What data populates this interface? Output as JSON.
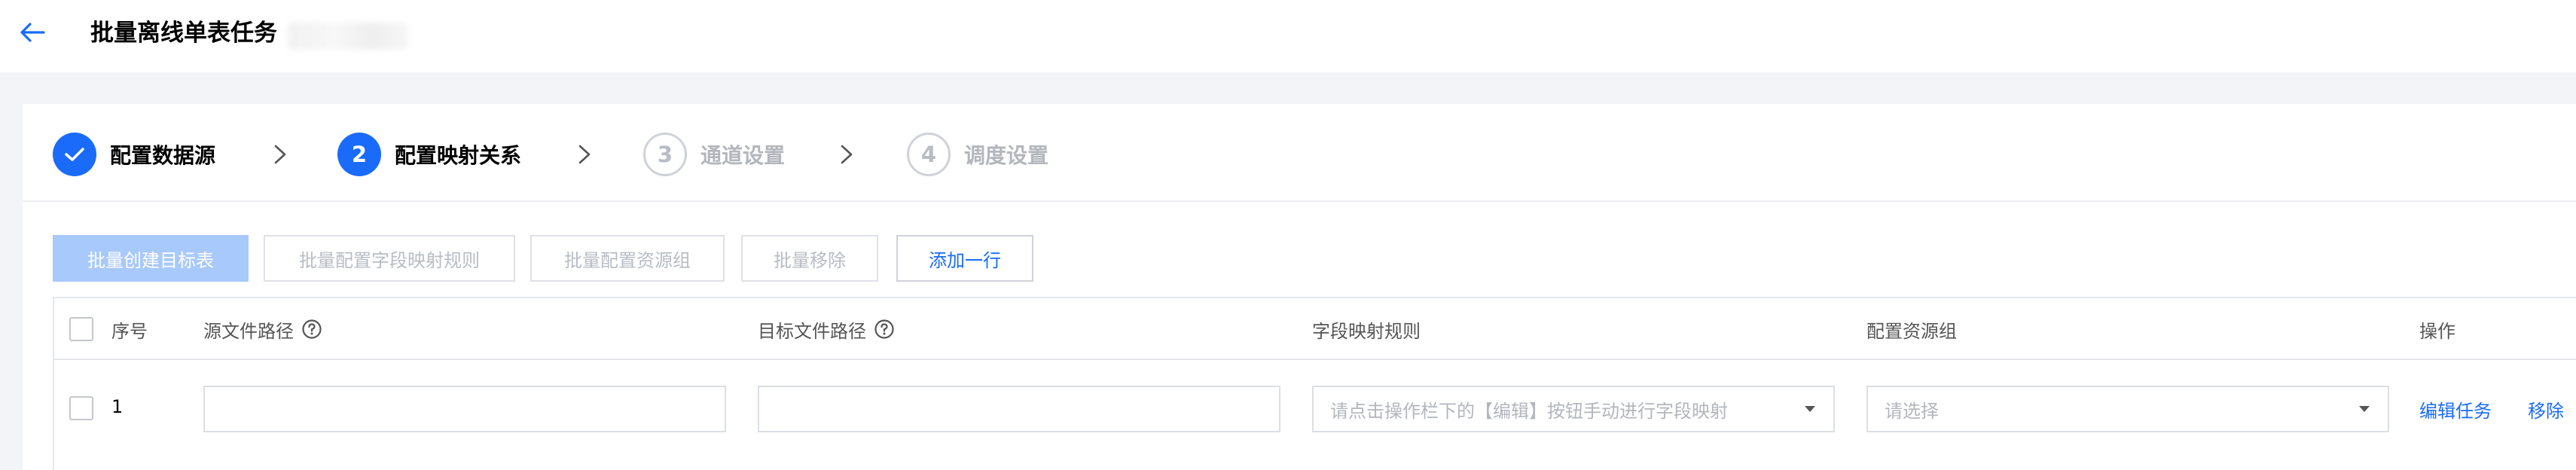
{
  "header": {
    "title": "批量离线单表任务",
    "back_icon": "arrow-left-icon"
  },
  "steps": [
    {
      "index": "1",
      "label": "配置数据源",
      "state": "done"
    },
    {
      "index": "2",
      "label": "配置映射关系",
      "state": "active"
    },
    {
      "index": "3",
      "label": "通道设置",
      "state": "todo"
    },
    {
      "index": "4",
      "label": "调度设置",
      "state": "todo"
    }
  ],
  "toolbar": {
    "batch_create_target": "批量创建目标表",
    "batch_field_mapping": "批量配置字段映射规则",
    "batch_resource_group": "批量配置资源组",
    "batch_remove": "批量移除",
    "add_row": "添加一行"
  },
  "table": {
    "columns": {
      "index": "序号",
      "source_path": "源文件路径",
      "target_path": "目标文件路径",
      "field_mapping": "字段映射规则",
      "resource_group": "配置资源组",
      "actions": "操作"
    },
    "rows": [
      {
        "index": "1",
        "source_path": "",
        "target_path": "",
        "field_mapping_placeholder": "请点击操作栏下的【编辑】按钮手动进行字段映射",
        "resource_group_placeholder": "请选择",
        "edit_action": "编辑任务",
        "remove_action": "移除"
      }
    ]
  },
  "colors": {
    "accent": "#1a6bfa",
    "disabled_primary": "#a8c9fb",
    "muted_text": "#b3b6bc",
    "page_background": "#f3f4f7"
  }
}
